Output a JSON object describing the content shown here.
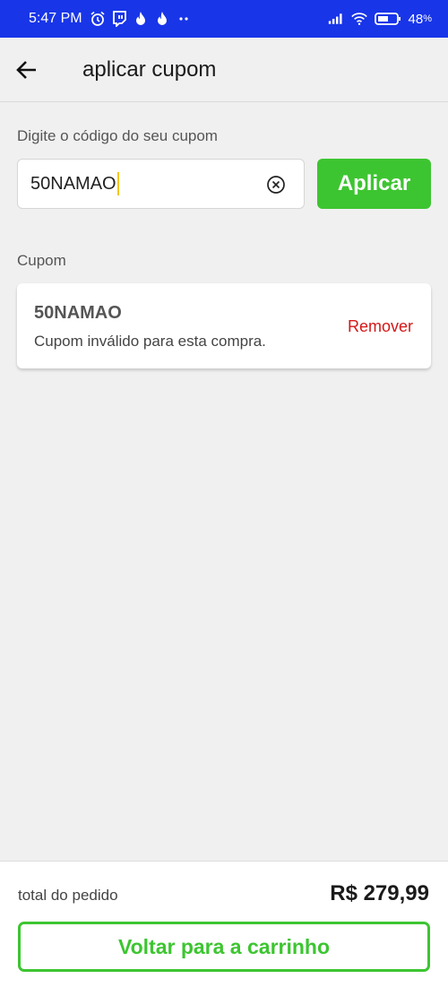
{
  "status_bar": {
    "time": "5:47 PM",
    "left_icons": [
      "alarm-icon",
      "twitch-icon",
      "flame-icon",
      "flame-icon",
      "more-dots-icon"
    ],
    "right_icons": [
      "signal-icon",
      "wifi-icon",
      "battery-icon"
    ],
    "battery_percent": "48",
    "battery_unit": "%",
    "background": "#1835e8"
  },
  "app_bar": {
    "back_icon": "arrow-left-icon",
    "title": "aplicar cupom"
  },
  "coupon_form": {
    "label": "Digite o código do seu cupom",
    "input_value": "50NAMAO",
    "clear_icon": "clear-circle-icon",
    "apply_label": "Aplicar",
    "apply_color": "#3dc531"
  },
  "coupon_section": {
    "label": "Cupom",
    "code": "50NAMAO",
    "message": "Cupom inválido para esta compra.",
    "remove_label": "Remover",
    "remove_color": "#d51717"
  },
  "footer": {
    "total_label": "total do pedido",
    "total_value": "R$ 279,99",
    "back_to_cart_label": "Voltar para a carrinho"
  }
}
